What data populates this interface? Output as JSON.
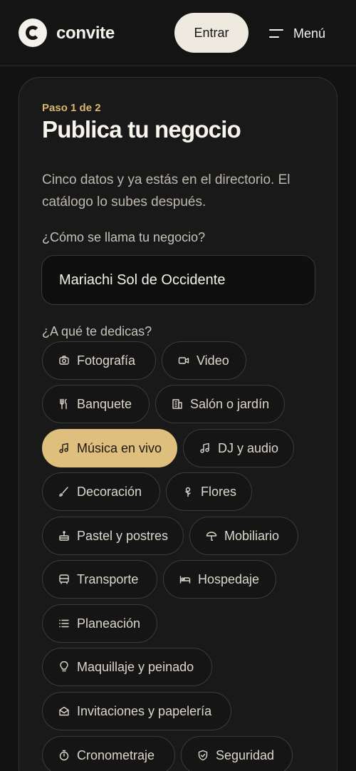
{
  "header": {
    "brand": "convite",
    "login_label": "Entrar",
    "menu_label": "Menú"
  },
  "form": {
    "step": "Paso 1 de 2",
    "title": "Publica tu negocio",
    "description": "Cinco datos y ya estás en el directorio. El catálogo lo subes después.",
    "name_label": "¿Cómo se llama tu negocio?",
    "name_value": "Mariachi Sol de Occidente",
    "category_label": "¿A qué te dedicas?",
    "selected_category": "Música en vivo",
    "accent_color": "#dfbf7d",
    "categories": [
      {
        "label": "Fotografía",
        "icon": "camera-icon"
      },
      {
        "label": "Video",
        "icon": "video-icon"
      },
      {
        "label": "Banquete",
        "icon": "utensils-icon"
      },
      {
        "label": "Salón o jardín",
        "icon": "building-icon"
      },
      {
        "label": "Música en vivo",
        "icon": "music-note-icon"
      },
      {
        "label": "DJ y audio",
        "icon": "music-note-icon"
      },
      {
        "label": "Decoración",
        "icon": "brush-icon"
      },
      {
        "label": "Flores",
        "icon": "flower-icon"
      },
      {
        "label": "Pastel y postres",
        "icon": "cake-icon"
      },
      {
        "label": "Mobiliario",
        "icon": "umbrella-icon"
      },
      {
        "label": "Transporte",
        "icon": "bus-icon"
      },
      {
        "label": "Hospedaje",
        "icon": "bed-icon"
      },
      {
        "label": "Planeación",
        "icon": "list-icon"
      },
      {
        "label": "Maquillaje y peinado",
        "icon": "lightbulb-icon"
      },
      {
        "label": "Invitaciones y papelería",
        "icon": "envelope-icon"
      },
      {
        "label": "Cronometraje",
        "icon": "timer-icon"
      },
      {
        "label": "Seguridad",
        "icon": "shield-icon"
      }
    ]
  }
}
